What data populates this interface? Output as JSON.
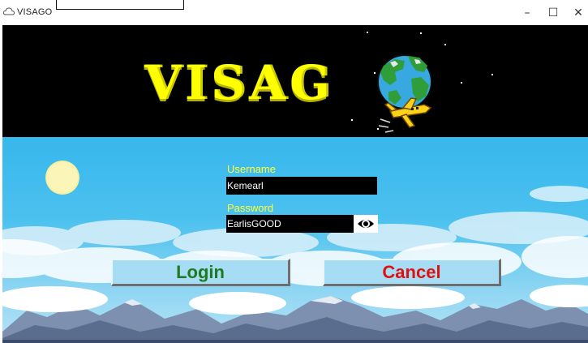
{
  "window": {
    "title": "VISAGO",
    "controls": {
      "minimize": "–",
      "maximize": "☐",
      "close": "✕"
    }
  },
  "header": {
    "logo_text": "VISAG",
    "logo_icon": "globe-airplane-icon",
    "background_color": "#000000",
    "logo_color": "#ffff00"
  },
  "login_form": {
    "username_label": "Username",
    "username_value": "Kemearl",
    "password_label": "Password",
    "password_value": "EarlisGOOD",
    "show_password_icon": "eye-icon",
    "label_color": "#ffff33"
  },
  "buttons": {
    "login": "Login",
    "cancel": "Cancel",
    "login_color": "#1e7a1e",
    "cancel_color": "#e01010"
  },
  "background": {
    "scene": "pixel-art sky with sun, clouds and mountains"
  }
}
